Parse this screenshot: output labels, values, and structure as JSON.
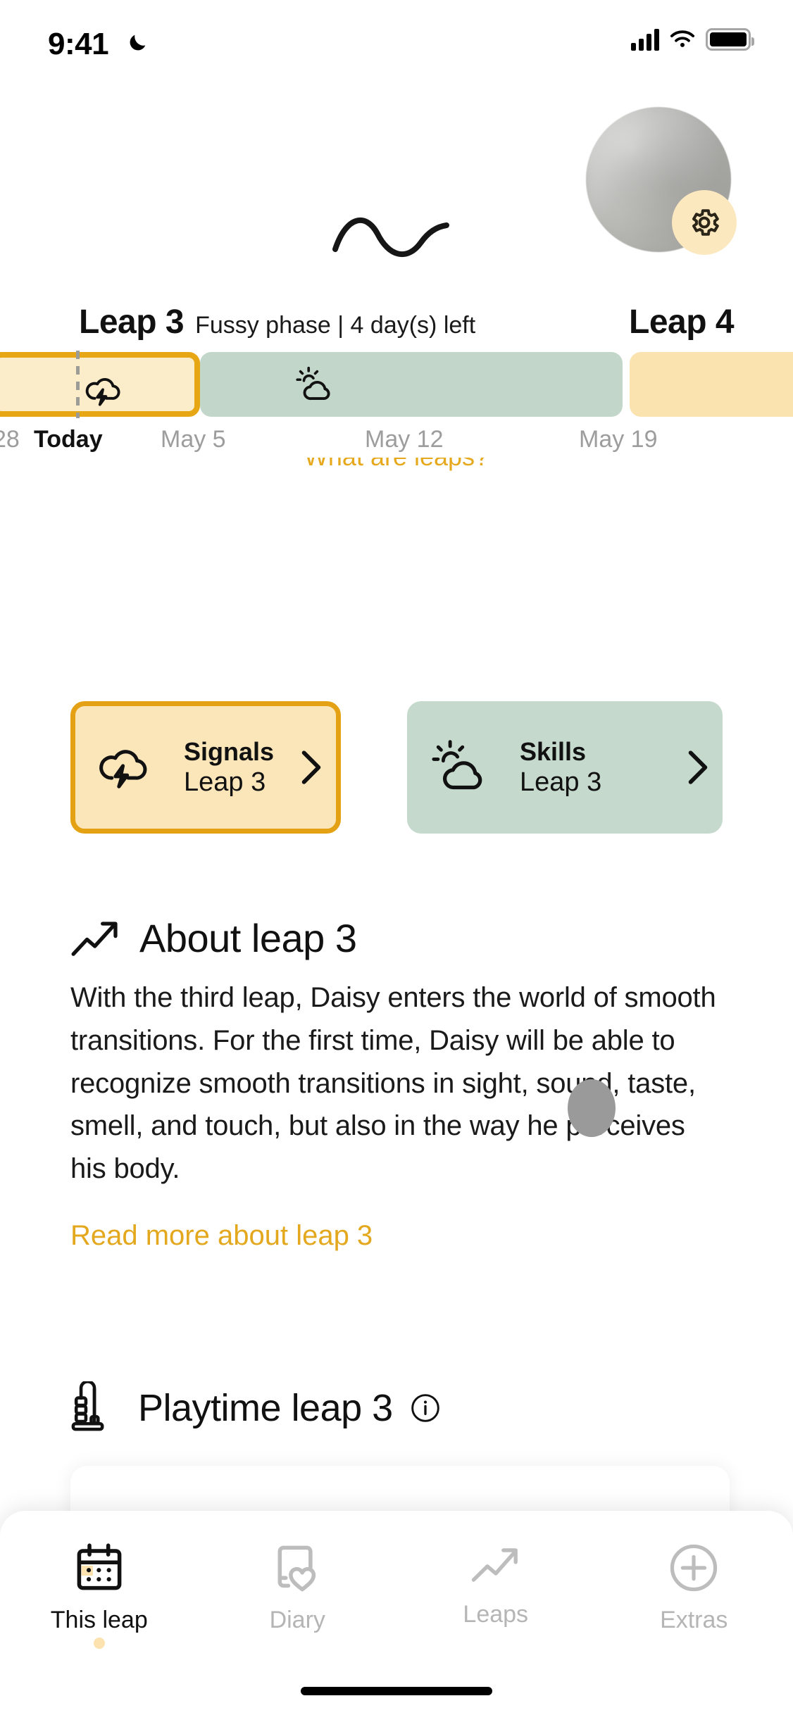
{
  "status_bar": {
    "time": "9:41",
    "icons": [
      "moon-icon",
      "cellular-signal-icon",
      "wifi-icon",
      "battery-icon"
    ]
  },
  "header": {
    "avatar_label": "profile-photo",
    "settings_icon": "gear-icon",
    "decoration": "wave-squiggle"
  },
  "timeline": {
    "current_leap": "Leap 3",
    "current_leap_status": "Fussy phase | 4 day(s) left",
    "next_leap": "Leap 4",
    "segments": [
      {
        "name": "fussy-phase",
        "icon": "storm-cloud-icon",
        "color": "#FCEDCA",
        "border_color": "#E7A614"
      },
      {
        "name": "skills-phase",
        "icon": "sun-cloud-icon",
        "color": "#C3D6CA"
      },
      {
        "name": "leap-4",
        "icon": "",
        "color": "#FBE3B0"
      }
    ],
    "dates": [
      {
        "label": "28",
        "today": false
      },
      {
        "label": "Today",
        "today": true
      },
      {
        "label": "May 5",
        "today": false
      },
      {
        "label": "May 12",
        "today": false
      },
      {
        "label": "May 19",
        "today": false
      }
    ],
    "what_are_leaps_link": "What are leaps?"
  },
  "cards": [
    {
      "title": "Signals",
      "subtitle": "Leap 3",
      "icon": "storm-cloud-icon",
      "bg": "#FBE6B9",
      "border": "#E3A113"
    },
    {
      "title": "Skills",
      "subtitle": "Leap 3",
      "icon": "sun-cloud-icon",
      "bg": "#C5D9CD"
    }
  ],
  "about": {
    "icon": "trending-up-icon",
    "heading": "About leap 3",
    "body": "With the third leap, Daisy  enters the world of smooth transitions. For the first time, Daisy will be able to recognize smooth transitions in sight, sound, taste, smell, and touch, but also in the way he perceives his body.",
    "read_more": "Read more about leap 3",
    "link_color": "#E3A81E"
  },
  "playtime": {
    "icon": "baby-gym-icon",
    "heading": "Playtime leap 3",
    "info_icon": "info-circle-icon"
  },
  "tab_bar": {
    "tabs": [
      {
        "label": "This leap",
        "icon": "calendar-icon",
        "active": true
      },
      {
        "label": "Diary",
        "icon": "diary-heart-icon",
        "active": false
      },
      {
        "label": "Leaps",
        "icon": "trending-up-icon",
        "active": false
      },
      {
        "label": "Extras",
        "icon": "plus-circle-icon",
        "active": false
      }
    ]
  },
  "colors": {
    "accent_yellow": "#E3A81E",
    "accent_orange": "#E7A614",
    "cream": "#FBE6B9",
    "sage": "#C5D9CD",
    "muted_text": "#9d9d9d"
  }
}
